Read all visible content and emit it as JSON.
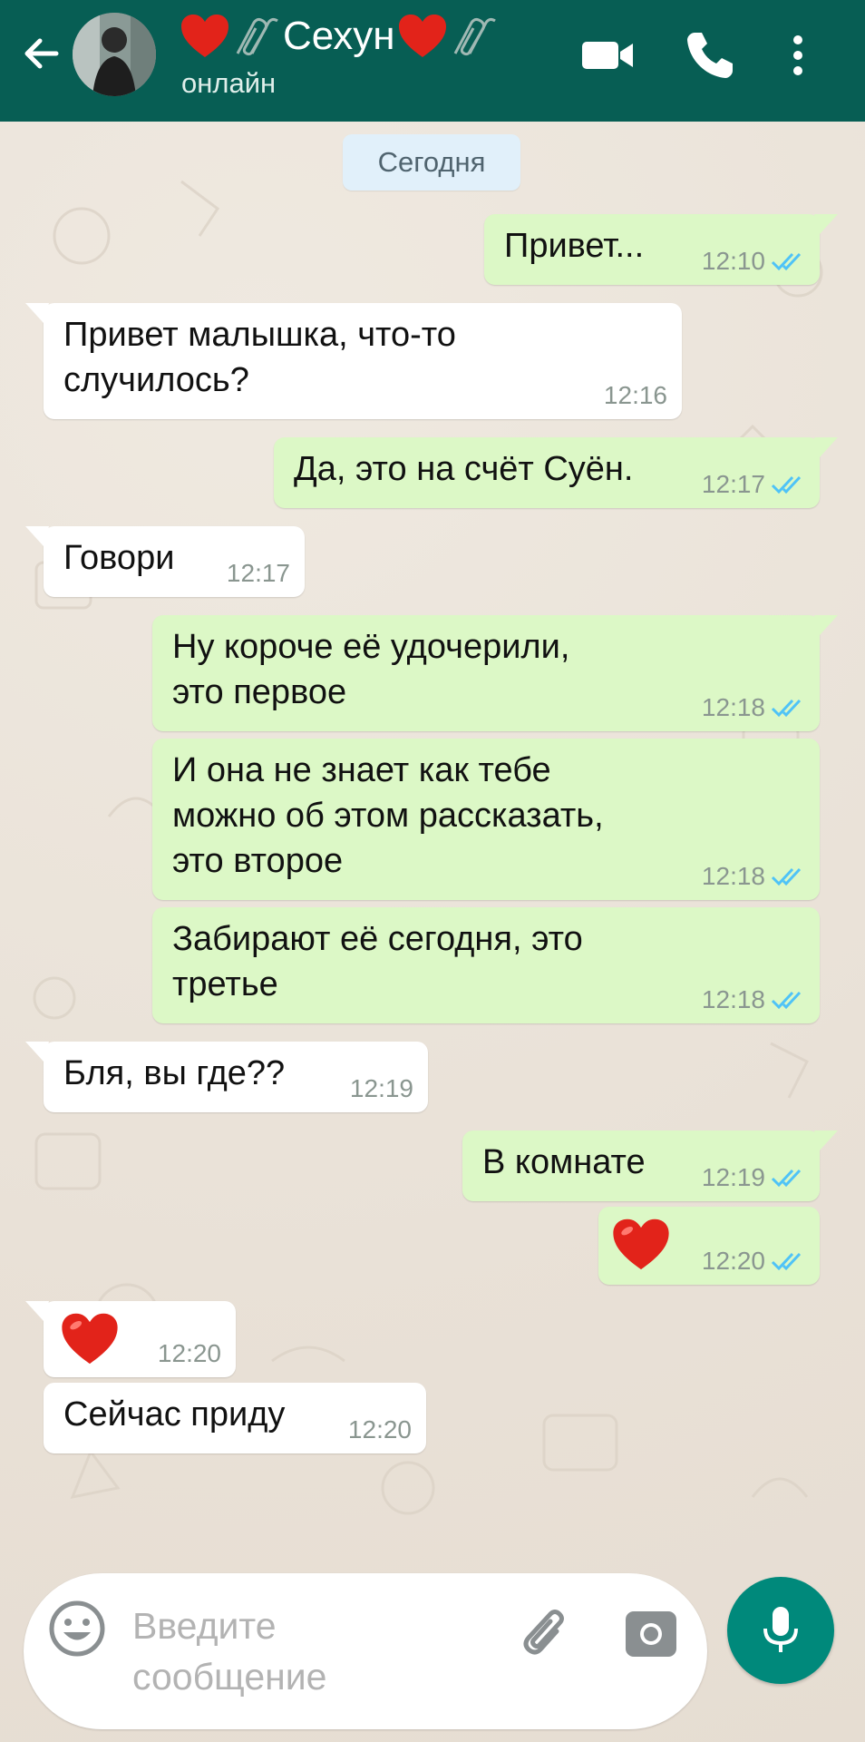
{
  "header": {
    "contact_name": "Сехун",
    "status": "онлайн"
  },
  "date_chip": "Сегодня",
  "messages": [
    {
      "dir": "out",
      "text": "Привет...",
      "time": "12:10",
      "read": true
    },
    {
      "dir": "in",
      "text": "Привет малышка, что-то\nслучилось?",
      "time": "12:16"
    },
    {
      "dir": "out",
      "text": "Да, это на счёт Суён.",
      "time": "12:17",
      "read": true
    },
    {
      "dir": "in",
      "text": "Говори",
      "time": "12:17"
    },
    {
      "dir": "out",
      "text": "Ну короче её удочерили,\nэто первое",
      "time": "12:18",
      "read": true
    },
    {
      "dir": "out",
      "text": "И она не знает как тебе\nможно об этом рассказать,\nэто второе",
      "time": "12:18",
      "read": true
    },
    {
      "dir": "out",
      "text": "Забирают её сегодня, это\nтретье",
      "time": "12:18",
      "read": true
    },
    {
      "dir": "in",
      "text": "Бля, вы где??",
      "time": "12:19"
    },
    {
      "dir": "out",
      "text": "В комнате",
      "time": "12:19",
      "read": true
    },
    {
      "dir": "out",
      "emoji": "red-heart",
      "time": "12:20",
      "read": true
    },
    {
      "dir": "in",
      "emoji": "red-heart",
      "time": "12:20"
    },
    {
      "dir": "in",
      "text": "Сейчас приду",
      "time": "12:20"
    }
  ],
  "composer": {
    "placeholder": "Введите\nсообщение"
  },
  "colors": {
    "header": "#075e54",
    "outgoing_bubble": "#dcf8c6",
    "incoming_bubble": "#ffffff",
    "read_ticks": "#4fc3f7",
    "mic_button": "#00897b"
  }
}
